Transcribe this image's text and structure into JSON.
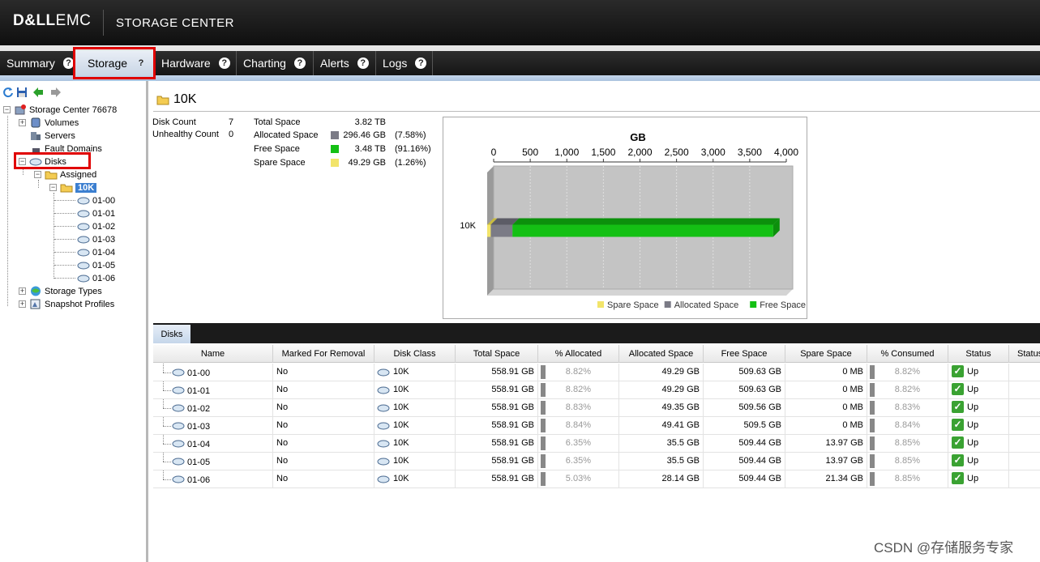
{
  "header": {
    "logo_bold": "D&LL",
    "logo_rest": "EMC",
    "product": "STORAGE CENTER"
  },
  "nav": {
    "tabs": [
      {
        "label": "Summary",
        "help": "?"
      },
      {
        "label": "Storage",
        "help": "?"
      },
      {
        "label": "Hardware",
        "help": "?"
      },
      {
        "label": "Charting",
        "help": "?"
      },
      {
        "label": "Alerts",
        "help": "?"
      },
      {
        "label": "Logs",
        "help": "?"
      }
    ]
  },
  "tree": {
    "root": "Storage Center 76678",
    "items": [
      "Volumes",
      "Servers",
      "Fault Domains",
      "Disks",
      "Assigned",
      "10K"
    ],
    "disks": [
      "01-00",
      "01-01",
      "01-02",
      "01-03",
      "01-04",
      "01-05",
      "01-06"
    ],
    "bottom": [
      "Storage Types",
      "Snapshot Profiles"
    ]
  },
  "summary": {
    "title": "10K",
    "disk_count_label": "Disk Count",
    "disk_count": "7",
    "unhealthy_label": "Unhealthy Count",
    "unhealthy": "0",
    "total_label": "Total Space",
    "total": "3.82 TB",
    "alloc_label": "Allocated Space",
    "alloc": "296.46 GB",
    "alloc_pct": "(7.58%)",
    "free_label": "Free Space",
    "free": "3.48 TB",
    "free_pct": "(91.16%)",
    "spare_label": "Spare Space",
    "spare": "49.29 GB",
    "spare_pct": "(1.26%)"
  },
  "colors": {
    "spare": "#f2e46a",
    "allocated": "#7b7b86",
    "free": "#14c014",
    "accent": "#3c7fd0"
  },
  "chart_data": {
    "type": "bar",
    "orientation": "horizontal",
    "stacked": true,
    "title": "GB",
    "categories": [
      "10K"
    ],
    "series": [
      {
        "name": "Spare Space",
        "values": [
          49.29
        ]
      },
      {
        "name": "Allocated Space",
        "values": [
          296.46
        ]
      },
      {
        "name": "Free Space",
        "values": [
          3563.5
        ]
      }
    ],
    "xlim": [
      0,
      4000
    ],
    "ticks": [
      "0",
      "500",
      "1,000",
      "1,500",
      "2,000",
      "2,500",
      "3,000",
      "3,500",
      "4,000"
    ],
    "legend_position": "bottom-right",
    "grid": true
  },
  "table": {
    "tab": "Disks",
    "columns": [
      "Name",
      "Marked For Removal",
      "Disk Class",
      "Total Space",
      "% Allocated",
      "Allocated Space",
      "Free Space",
      "Spare Space",
      "% Consumed",
      "Status",
      "Status"
    ],
    "rows": [
      {
        "name": "01-00",
        "removal": "No",
        "class": "10K",
        "total": "558.91 GB",
        "pct_alloc": "8.82%",
        "alloc": "49.29 GB",
        "free": "509.63 GB",
        "spare": "0 MB",
        "pct_cons": "8.82%",
        "status": "Up"
      },
      {
        "name": "01-01",
        "removal": "No",
        "class": "10K",
        "total": "558.91 GB",
        "pct_alloc": "8.82%",
        "alloc": "49.29 GB",
        "free": "509.63 GB",
        "spare": "0 MB",
        "pct_cons": "8.82%",
        "status": "Up"
      },
      {
        "name": "01-02",
        "removal": "No",
        "class": "10K",
        "total": "558.91 GB",
        "pct_alloc": "8.83%",
        "alloc": "49.35 GB",
        "free": "509.56 GB",
        "spare": "0 MB",
        "pct_cons": "8.83%",
        "status": "Up"
      },
      {
        "name": "01-03",
        "removal": "No",
        "class": "10K",
        "total": "558.91 GB",
        "pct_alloc": "8.84%",
        "alloc": "49.41 GB",
        "free": "509.5 GB",
        "spare": "0 MB",
        "pct_cons": "8.84%",
        "status": "Up"
      },
      {
        "name": "01-04",
        "removal": "No",
        "class": "10K",
        "total": "558.91 GB",
        "pct_alloc": "6.35%",
        "alloc": "35.5 GB",
        "free": "509.44 GB",
        "spare": "13.97 GB",
        "pct_cons": "8.85%",
        "status": "Up"
      },
      {
        "name": "01-05",
        "removal": "No",
        "class": "10K",
        "total": "558.91 GB",
        "pct_alloc": "6.35%",
        "alloc": "35.5 GB",
        "free": "509.44 GB",
        "spare": "13.97 GB",
        "pct_cons": "8.85%",
        "status": "Up"
      },
      {
        "name": "01-06",
        "removal": "No",
        "class": "10K",
        "total": "558.91 GB",
        "pct_alloc": "5.03%",
        "alloc": "28.14 GB",
        "free": "509.44 GB",
        "spare": "21.34 GB",
        "pct_cons": "8.85%",
        "status": "Up"
      }
    ]
  },
  "watermark": "CSDN @存储服务专家"
}
